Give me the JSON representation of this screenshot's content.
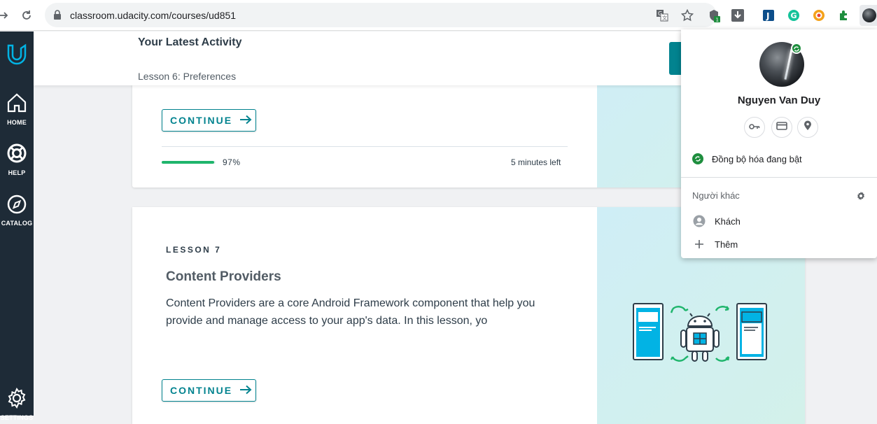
{
  "browser": {
    "url": "classroom.udacity.com/courses/ud851"
  },
  "leftnav": {
    "items": [
      {
        "label": "HOME"
      },
      {
        "label": "HELP"
      },
      {
        "label": "CATALOG"
      },
      {
        "label": "SETTINGS"
      }
    ]
  },
  "activity": {
    "title": "Your Latest Activity",
    "subtitle": "Lesson 6: Preferences"
  },
  "card1": {
    "continue_label": "CONTINUE",
    "progress_pct_text": "97%",
    "progress_fraction": 0.97,
    "time_left": "5 minutes left"
  },
  "card2": {
    "lesson_number": "LESSON 7",
    "title": "Content Providers",
    "description": "Content Providers are a core Android Framework component that help you provide and manage access to your app's data. In this lesson, yo",
    "continue_label": "CONTINUE"
  },
  "profile": {
    "name": "Nguyen Van Duy",
    "sync_text": "Đồng bộ hóa đang bật",
    "others_label": "Người khác",
    "guest_label": "Khách",
    "add_label": "Thêm"
  },
  "colors": {
    "accent": "#02838f",
    "nav_bg": "#1e2b37",
    "progress": "#1fb56c",
    "sync_green": "#1e8e3e"
  }
}
